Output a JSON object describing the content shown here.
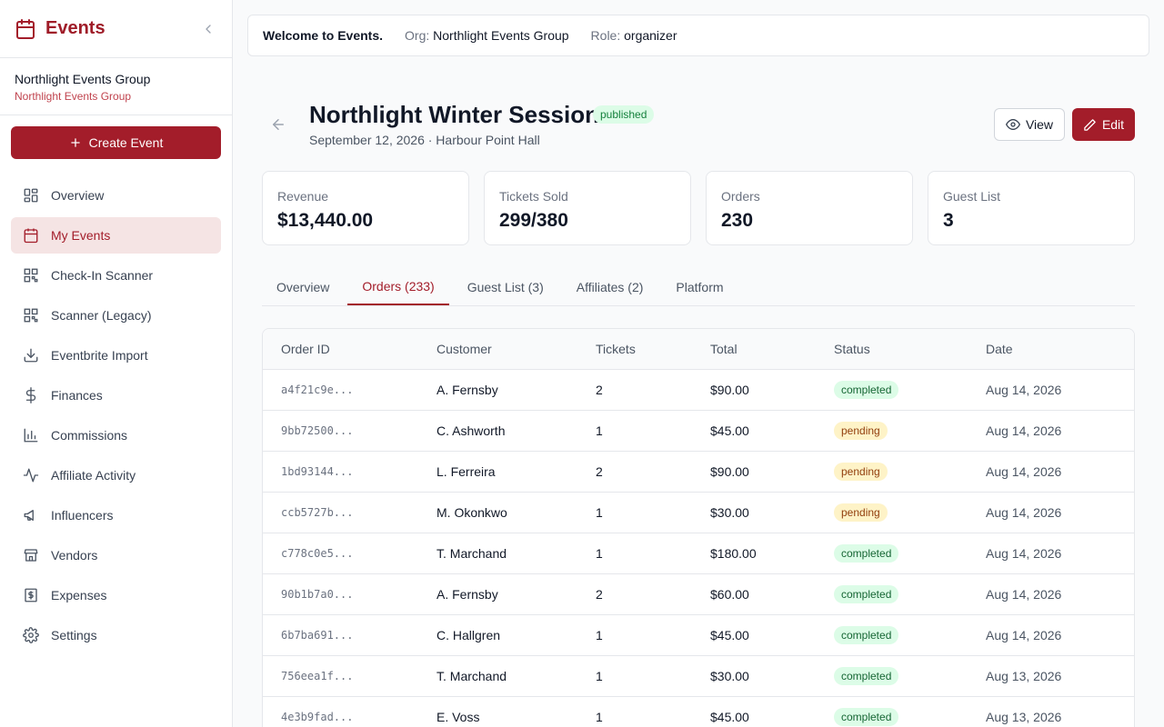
{
  "brand": {
    "title": "Events"
  },
  "org": {
    "name": "Northlight Events Group",
    "sub": "Northlight Events Group"
  },
  "sidebar": {
    "create_label": "Create Event",
    "items": [
      {
        "label": "Overview",
        "icon": "grid-icon"
      },
      {
        "label": "My Events",
        "icon": "calendar-icon",
        "active": true
      },
      {
        "label": "Check-In Scanner",
        "icon": "qr-code-icon"
      },
      {
        "label": "Scanner (Legacy)",
        "icon": "qr-code-icon"
      },
      {
        "label": "Eventbrite Import",
        "icon": "download-icon"
      },
      {
        "label": "Finances",
        "icon": "dollar-icon"
      },
      {
        "label": "Commissions",
        "icon": "bar-chart-icon"
      },
      {
        "label": "Affiliate Activity",
        "icon": "activity-icon"
      },
      {
        "label": "Influencers",
        "icon": "megaphone-icon"
      },
      {
        "label": "Vendors",
        "icon": "store-icon"
      },
      {
        "label": "Expenses",
        "icon": "receipt-icon"
      },
      {
        "label": "Settings",
        "icon": "gear-icon"
      }
    ]
  },
  "header": {
    "welcome": "Welcome to Events.",
    "org_label": "Org:",
    "org_value": "Northlight Events Group",
    "role_label": "Role:",
    "role_value": "organizer"
  },
  "event": {
    "title": "Northlight Winter Session",
    "status": "published",
    "subtitle": "September 12, 2026 · Harbour Point Hall",
    "view_label": "View",
    "edit_label": "Edit"
  },
  "stats": [
    {
      "label": "Revenue",
      "value": "$13,440.00"
    },
    {
      "label": "Tickets Sold",
      "value": "299/380"
    },
    {
      "label": "Orders",
      "value": "230"
    },
    {
      "label": "Guest List",
      "value": "3"
    }
  ],
  "tabs": [
    {
      "label": "Overview"
    },
    {
      "label": "Orders (233)",
      "active": true
    },
    {
      "label": "Guest List (3)"
    },
    {
      "label": "Affiliates (2)"
    },
    {
      "label": "Platform"
    }
  ],
  "table": {
    "columns": [
      "Order ID",
      "Customer",
      "Tickets",
      "Total",
      "Status",
      "Date"
    ],
    "rows": [
      {
        "id": "a4f21c9e...",
        "customer": "A. Fernsby",
        "tickets": "2",
        "total": "$90.00",
        "status": "completed",
        "date": "Aug 14, 2026"
      },
      {
        "id": "9bb72500...",
        "customer": "C. Ashworth",
        "tickets": "1",
        "total": "$45.00",
        "status": "pending",
        "date": "Aug 14, 2026"
      },
      {
        "id": "1bd93144...",
        "customer": "L. Ferreira",
        "tickets": "2",
        "total": "$90.00",
        "status": "pending",
        "date": "Aug 14, 2026"
      },
      {
        "id": "ccb5727b...",
        "customer": "M. Okonkwo",
        "tickets": "1",
        "total": "$30.00",
        "status": "pending",
        "date": "Aug 14, 2026"
      },
      {
        "id": "c778c0e5...",
        "customer": "T. Marchand",
        "tickets": "1",
        "total": "$180.00",
        "status": "completed",
        "date": "Aug 14, 2026"
      },
      {
        "id": "90b1b7a0...",
        "customer": "A. Fernsby",
        "tickets": "2",
        "total": "$60.00",
        "status": "completed",
        "date": "Aug 14, 2026"
      },
      {
        "id": "6b7ba691...",
        "customer": "C. Hallgren",
        "tickets": "1",
        "total": "$45.00",
        "status": "completed",
        "date": "Aug 14, 2026"
      },
      {
        "id": "756eea1f...",
        "customer": "T. Marchand",
        "tickets": "1",
        "total": "$30.00",
        "status": "completed",
        "date": "Aug 13, 2026"
      },
      {
        "id": "4e3b9fad...",
        "customer": "E. Voss",
        "tickets": "1",
        "total": "$45.00",
        "status": "completed",
        "date": "Aug 13, 2026"
      }
    ]
  },
  "colors": {
    "brand": "#a31d2a",
    "active_bg": "#f5e4e4",
    "completed_bg": "#dcfce7",
    "pending_bg": "#fef3c7"
  }
}
